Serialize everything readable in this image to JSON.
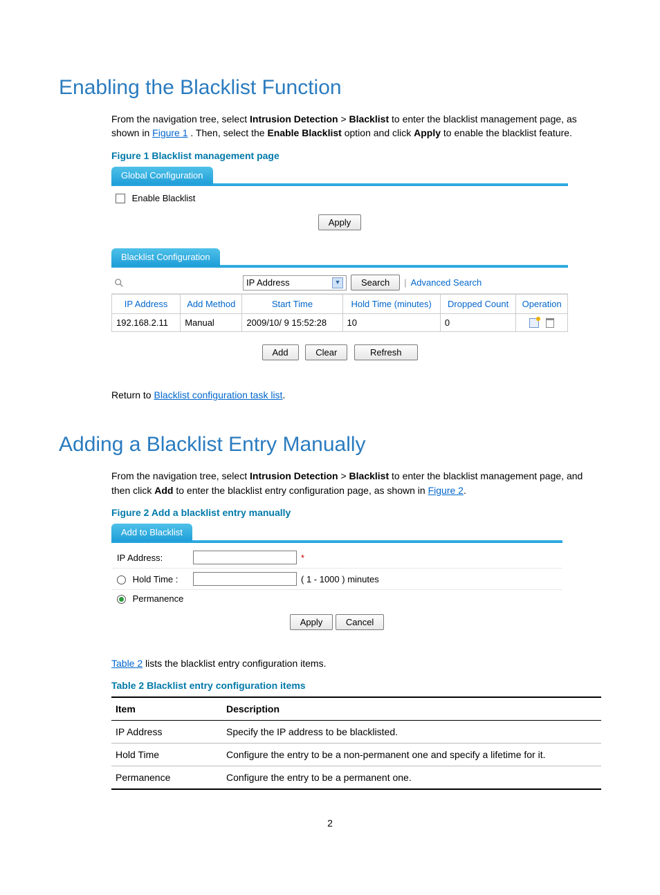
{
  "h1a": "Enabling the Blacklist Function",
  "p1": {
    "pre": "From the navigation tree, select ",
    "b1": "Intrusion Detection",
    "sep": " > ",
    "b2": "Blacklist",
    "mid1": " to enter the blacklist management page, as shown in ",
    "link1": "Figure 1",
    "mid2": ". Then, select the ",
    "b3": "Enable Blacklist",
    "mid3": " option and click ",
    "b4": "Apply",
    "end": " to enable the blacklist feature."
  },
  "fig1_caption": "Figure 1 Blacklist management page",
  "fig1": {
    "tab_global": "Global Configuration",
    "enable_label": "Enable Blacklist",
    "apply": "Apply",
    "tab_blk": "Blacklist Configuration",
    "select_label": "IP Address",
    "search_btn": "Search",
    "adv_search": "Advanced Search",
    "headers": {
      "ip": "IP Address",
      "method": "Add Method",
      "start": "Start Time",
      "hold": "Hold Time (minutes)",
      "dropped": "Dropped Count",
      "op": "Operation"
    },
    "row": {
      "ip": "192.168.2.11",
      "method": "Manual",
      "start": "2009/10/ 9 15:52:28",
      "hold": "10",
      "dropped": "0"
    },
    "btn_add": "Add",
    "btn_clear": "Clear",
    "btn_refresh": "Refresh"
  },
  "return_pre": "Return to ",
  "return_link": "Blacklist configuration task list",
  "return_post": ".",
  "h1b": "Adding a Blacklist Entry Manually",
  "p2": {
    "pre": "From the navigation tree, select ",
    "b1": "Intrusion Detection",
    "sep": " > ",
    "b2": "Blacklist",
    "mid1": " to enter the blacklist management page, and then click ",
    "b3": "Add",
    "mid2": " to enter the blacklist entry configuration page, as shown in ",
    "link": "Figure 2",
    "end": "."
  },
  "fig2_caption": "Figure 2 Add a blacklist entry manually",
  "fig2": {
    "tab": "Add to Blacklist",
    "ip_lbl": "IP Address:",
    "star": "*",
    "hold_lbl": "Hold Time :",
    "hold_note": "( 1 - 1000 ) minutes",
    "perm_lbl": "Permanence",
    "apply": "Apply",
    "cancel": "Cancel"
  },
  "p3_pre": "",
  "p3_link": "Table 2",
  "p3_post": " lists the blacklist entry configuration items.",
  "tbl2_caption": "Table 2 Blacklist entry configuration items",
  "tbl2": {
    "h_item": "Item",
    "h_desc": "Description",
    "r1_item": "IP Address",
    "r1_desc": "Specify the IP address to be blacklisted.",
    "r2_item": "Hold Time",
    "r2_desc": "Configure the entry to be a non-permanent one and specify a lifetime for it.",
    "r3_item": "Permanence",
    "r3_desc": "Configure the entry to be a permanent one."
  },
  "page_no": "2"
}
